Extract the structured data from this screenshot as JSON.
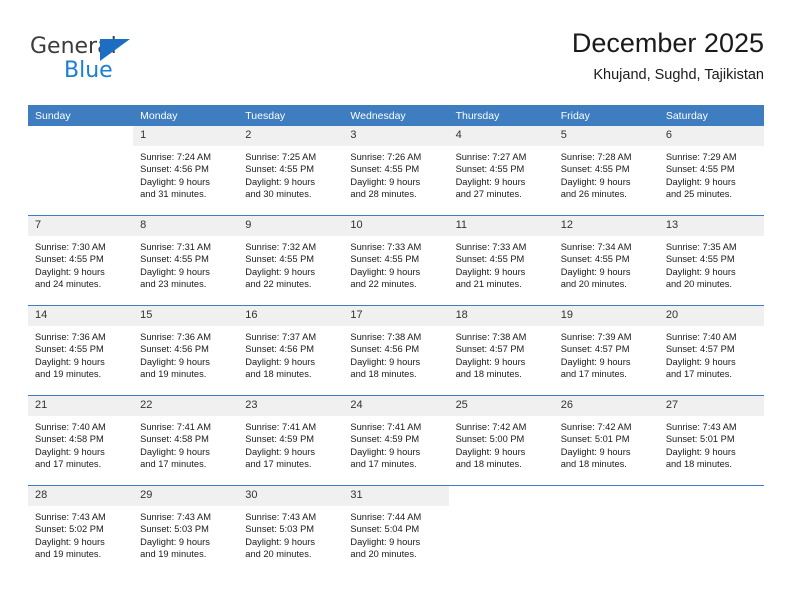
{
  "logo": {
    "word_one": "General",
    "word_two": "Blue",
    "triangle_color": "#1b6ec2",
    "blue_color": "#1b7fd4"
  },
  "header": {
    "title": "December 2025",
    "subtitle": "Khujand, Sughd, Tajikistan"
  },
  "calendar": {
    "header_bg": "#3d7dc0",
    "daynum_bg": "#f0f0f0",
    "weekdays": [
      "Sunday",
      "Monday",
      "Tuesday",
      "Wednesday",
      "Thursday",
      "Friday",
      "Saturday"
    ],
    "weeks": [
      [
        {
          "day": "",
          "sunrise": "",
          "sunset": "",
          "daylight_line1": "",
          "daylight_line2": ""
        },
        {
          "day": "1",
          "sunrise": "Sunrise: 7:24 AM",
          "sunset": "Sunset: 4:56 PM",
          "daylight_line1": "Daylight: 9 hours",
          "daylight_line2": "and 31 minutes."
        },
        {
          "day": "2",
          "sunrise": "Sunrise: 7:25 AM",
          "sunset": "Sunset: 4:55 PM",
          "daylight_line1": "Daylight: 9 hours",
          "daylight_line2": "and 30 minutes."
        },
        {
          "day": "3",
          "sunrise": "Sunrise: 7:26 AM",
          "sunset": "Sunset: 4:55 PM",
          "daylight_line1": "Daylight: 9 hours",
          "daylight_line2": "and 28 minutes."
        },
        {
          "day": "4",
          "sunrise": "Sunrise: 7:27 AM",
          "sunset": "Sunset: 4:55 PM",
          "daylight_line1": "Daylight: 9 hours",
          "daylight_line2": "and 27 minutes."
        },
        {
          "day": "5",
          "sunrise": "Sunrise: 7:28 AM",
          "sunset": "Sunset: 4:55 PM",
          "daylight_line1": "Daylight: 9 hours",
          "daylight_line2": "and 26 minutes."
        },
        {
          "day": "6",
          "sunrise": "Sunrise: 7:29 AM",
          "sunset": "Sunset: 4:55 PM",
          "daylight_line1": "Daylight: 9 hours",
          "daylight_line2": "and 25 minutes."
        }
      ],
      [
        {
          "day": "7",
          "sunrise": "Sunrise: 7:30 AM",
          "sunset": "Sunset: 4:55 PM",
          "daylight_line1": "Daylight: 9 hours",
          "daylight_line2": "and 24 minutes."
        },
        {
          "day": "8",
          "sunrise": "Sunrise: 7:31 AM",
          "sunset": "Sunset: 4:55 PM",
          "daylight_line1": "Daylight: 9 hours",
          "daylight_line2": "and 23 minutes."
        },
        {
          "day": "9",
          "sunrise": "Sunrise: 7:32 AM",
          "sunset": "Sunset: 4:55 PM",
          "daylight_line1": "Daylight: 9 hours",
          "daylight_line2": "and 22 minutes."
        },
        {
          "day": "10",
          "sunrise": "Sunrise: 7:33 AM",
          "sunset": "Sunset: 4:55 PM",
          "daylight_line1": "Daylight: 9 hours",
          "daylight_line2": "and 22 minutes."
        },
        {
          "day": "11",
          "sunrise": "Sunrise: 7:33 AM",
          "sunset": "Sunset: 4:55 PM",
          "daylight_line1": "Daylight: 9 hours",
          "daylight_line2": "and 21 minutes."
        },
        {
          "day": "12",
          "sunrise": "Sunrise: 7:34 AM",
          "sunset": "Sunset: 4:55 PM",
          "daylight_line1": "Daylight: 9 hours",
          "daylight_line2": "and 20 minutes."
        },
        {
          "day": "13",
          "sunrise": "Sunrise: 7:35 AM",
          "sunset": "Sunset: 4:55 PM",
          "daylight_line1": "Daylight: 9 hours",
          "daylight_line2": "and 20 minutes."
        }
      ],
      [
        {
          "day": "14",
          "sunrise": "Sunrise: 7:36 AM",
          "sunset": "Sunset: 4:55 PM",
          "daylight_line1": "Daylight: 9 hours",
          "daylight_line2": "and 19 minutes."
        },
        {
          "day": "15",
          "sunrise": "Sunrise: 7:36 AM",
          "sunset": "Sunset: 4:56 PM",
          "daylight_line1": "Daylight: 9 hours",
          "daylight_line2": "and 19 minutes."
        },
        {
          "day": "16",
          "sunrise": "Sunrise: 7:37 AM",
          "sunset": "Sunset: 4:56 PM",
          "daylight_line1": "Daylight: 9 hours",
          "daylight_line2": "and 18 minutes."
        },
        {
          "day": "17",
          "sunrise": "Sunrise: 7:38 AM",
          "sunset": "Sunset: 4:56 PM",
          "daylight_line1": "Daylight: 9 hours",
          "daylight_line2": "and 18 minutes."
        },
        {
          "day": "18",
          "sunrise": "Sunrise: 7:38 AM",
          "sunset": "Sunset: 4:57 PM",
          "daylight_line1": "Daylight: 9 hours",
          "daylight_line2": "and 18 minutes."
        },
        {
          "day": "19",
          "sunrise": "Sunrise: 7:39 AM",
          "sunset": "Sunset: 4:57 PM",
          "daylight_line1": "Daylight: 9 hours",
          "daylight_line2": "and 17 minutes."
        },
        {
          "day": "20",
          "sunrise": "Sunrise: 7:40 AM",
          "sunset": "Sunset: 4:57 PM",
          "daylight_line1": "Daylight: 9 hours",
          "daylight_line2": "and 17 minutes."
        }
      ],
      [
        {
          "day": "21",
          "sunrise": "Sunrise: 7:40 AM",
          "sunset": "Sunset: 4:58 PM",
          "daylight_line1": "Daylight: 9 hours",
          "daylight_line2": "and 17 minutes."
        },
        {
          "day": "22",
          "sunrise": "Sunrise: 7:41 AM",
          "sunset": "Sunset: 4:58 PM",
          "daylight_line1": "Daylight: 9 hours",
          "daylight_line2": "and 17 minutes."
        },
        {
          "day": "23",
          "sunrise": "Sunrise: 7:41 AM",
          "sunset": "Sunset: 4:59 PM",
          "daylight_line1": "Daylight: 9 hours",
          "daylight_line2": "and 17 minutes."
        },
        {
          "day": "24",
          "sunrise": "Sunrise: 7:41 AM",
          "sunset": "Sunset: 4:59 PM",
          "daylight_line1": "Daylight: 9 hours",
          "daylight_line2": "and 17 minutes."
        },
        {
          "day": "25",
          "sunrise": "Sunrise: 7:42 AM",
          "sunset": "Sunset: 5:00 PM",
          "daylight_line1": "Daylight: 9 hours",
          "daylight_line2": "and 18 minutes."
        },
        {
          "day": "26",
          "sunrise": "Sunrise: 7:42 AM",
          "sunset": "Sunset: 5:01 PM",
          "daylight_line1": "Daylight: 9 hours",
          "daylight_line2": "and 18 minutes."
        },
        {
          "day": "27",
          "sunrise": "Sunrise: 7:43 AM",
          "sunset": "Sunset: 5:01 PM",
          "daylight_line1": "Daylight: 9 hours",
          "daylight_line2": "and 18 minutes."
        }
      ],
      [
        {
          "day": "28",
          "sunrise": "Sunrise: 7:43 AM",
          "sunset": "Sunset: 5:02 PM",
          "daylight_line1": "Daylight: 9 hours",
          "daylight_line2": "and 19 minutes."
        },
        {
          "day": "29",
          "sunrise": "Sunrise: 7:43 AM",
          "sunset": "Sunset: 5:03 PM",
          "daylight_line1": "Daylight: 9 hours",
          "daylight_line2": "and 19 minutes."
        },
        {
          "day": "30",
          "sunrise": "Sunrise: 7:43 AM",
          "sunset": "Sunset: 5:03 PM",
          "daylight_line1": "Daylight: 9 hours",
          "daylight_line2": "and 20 minutes."
        },
        {
          "day": "31",
          "sunrise": "Sunrise: 7:44 AM",
          "sunset": "Sunset: 5:04 PM",
          "daylight_line1": "Daylight: 9 hours",
          "daylight_line2": "and 20 minutes."
        },
        {
          "day": "",
          "sunrise": "",
          "sunset": "",
          "daylight_line1": "",
          "daylight_line2": ""
        },
        {
          "day": "",
          "sunrise": "",
          "sunset": "",
          "daylight_line1": "",
          "daylight_line2": ""
        },
        {
          "day": "",
          "sunrise": "",
          "sunset": "",
          "daylight_line1": "",
          "daylight_line2": ""
        }
      ]
    ]
  }
}
